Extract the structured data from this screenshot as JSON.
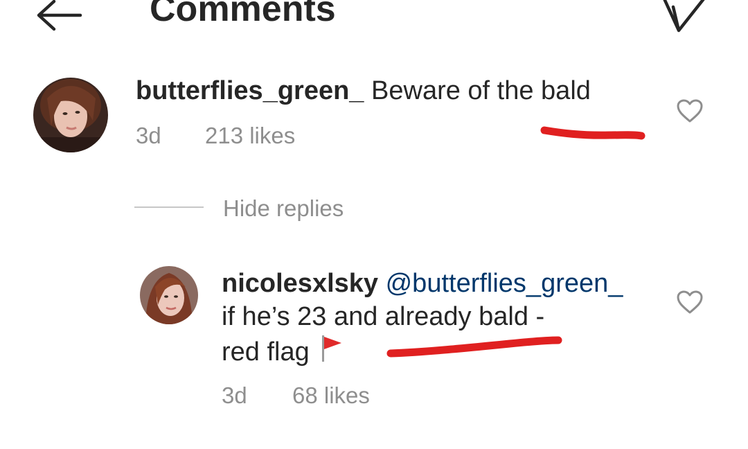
{
  "header": {
    "title": "Comments",
    "back_icon": "arrow-left-icon",
    "send_icon": "paper-plane-icon"
  },
  "comments": [
    {
      "username": "butterflies_green_",
      "text": "Beware of the bald",
      "time": "3d",
      "likes": "213 likes",
      "avatar_icon": "profile-photo",
      "like_icon": "heart-outline-icon"
    }
  ],
  "hide_replies_label": "Hide replies",
  "replies": [
    {
      "username": "nicolesxlsky",
      "mention": "@butterflies_green_",
      "line2": "if he’s 23 and already bald -",
      "line3": "red flag",
      "emoji": "triangular-flag-icon",
      "time": "3d",
      "likes": "68 likes",
      "avatar_icon": "profile-photo",
      "like_icon": "heart-outline-icon"
    }
  ],
  "colors": {
    "text": "#262626",
    "meta": "#8e8e8e",
    "mention": "#00376b",
    "marker": "#e02020"
  }
}
